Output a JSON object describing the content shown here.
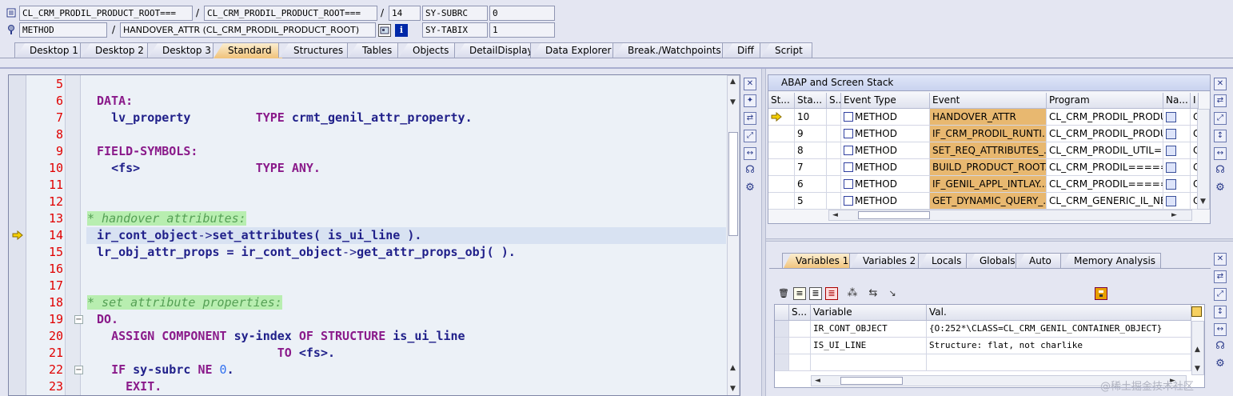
{
  "header": {
    "row1": {
      "class_name": "CL_CRM_PRODIL_PRODUCT_ROOT===",
      "include_name": "CL_CRM_PRODIL_PRODUCT_ROOT===",
      "line": "14",
      "sy_label": "SY-SUBRC",
      "sy_value": "0"
    },
    "row2": {
      "type": "METHOD",
      "method": "HANDOVER_ATTR (CL_CRM_PRODIL_PRODUCT_ROOT)",
      "sy_label": "SY-TABIX",
      "sy_value": "1"
    },
    "slash": "/"
  },
  "tabs": [
    "Desktop 1",
    "Desktop 2",
    "Desktop 3",
    "Standard",
    "Structures",
    "Tables",
    "Objects",
    "DetailDisplay",
    "Data Explorer",
    "Break./Watchpoints",
    "Diff",
    "Script"
  ],
  "active_tab": "Standard",
  "code_lines": [
    {
      "n": "5"
    },
    {
      "n": "6"
    },
    {
      "n": "7"
    },
    {
      "n": "8"
    },
    {
      "n": "9"
    },
    {
      "n": "10"
    },
    {
      "n": "11"
    },
    {
      "n": "12"
    },
    {
      "n": "13"
    },
    {
      "n": "14"
    },
    {
      "n": "15"
    },
    {
      "n": "16"
    },
    {
      "n": "17"
    },
    {
      "n": "18"
    },
    {
      "n": "19"
    },
    {
      "n": "20"
    },
    {
      "n": "21"
    },
    {
      "n": "22"
    },
    {
      "n": "23"
    }
  ],
  "code": {
    "l6_kw": "DATA:",
    "l7_var": "lv_property",
    "l7_type": "TYPE",
    "l7_ref": "crmt_genil_attr_property.",
    "l9_kw": "FIELD-SYMBOLS:",
    "l10_var": "<fs>",
    "l10_type": "TYPE",
    "l10_any": "ANY.",
    "l13_cmt": "* handover attributes:",
    "l14_a": "ir_cont_object",
    "l14_b": "->",
    "l14_c": "set_attributes",
    "l14_d": "( is_ui_line ).",
    "l15_a": "lr_obj_attr_props = ir_cont_object",
    "l15_b": "->",
    "l15_c": "get_attr_props_obj",
    "l15_d": "( ).",
    "l18_cmt": "* set attribute properties:",
    "l19_kw": "DO.",
    "l20_a": "ASSIGN COMPONENT",
    "l20_b": "sy-index",
    "l20_c": "OF STRUCTURE",
    "l20_d": "is_ui_line",
    "l21_a": "TO",
    "l21_b": "<fs>.",
    "l22_a": "IF",
    "l22_b": "sy-subrc",
    "l22_c": "NE",
    "l22_d": "0",
    "l22_e": ".",
    "l23_a": "EXIT."
  },
  "stack": {
    "title": "ABAP and Screen Stack",
    "headers": [
      "St...",
      "Sta...",
      "S...",
      "Event Type",
      "Event",
      "Program",
      "Na...",
      "I"
    ],
    "rows": [
      {
        "num": "10",
        "type": "METHOD",
        "event": "HANDOVER_ATTR",
        "program": "CL_CRM_PRODIL_PRODU...",
        "i": "C",
        "current": true
      },
      {
        "num": "9",
        "type": "METHOD",
        "event": "IF_CRM_PRODIL_RUNTI...",
        "program": "CL_CRM_PRODIL_PRODU...",
        "i": "C"
      },
      {
        "num": "8",
        "type": "METHOD",
        "event": "SET_REQ_ATTRIBUTES_...",
        "program": "CL_CRM_PRODIL_UTIL=...",
        "i": "C"
      },
      {
        "num": "7",
        "type": "METHOD",
        "event": "BUILD_PRODUCT_ROOT...",
        "program": "CL_CRM_PRODIL=====...",
        "i": "C"
      },
      {
        "num": "6",
        "type": "METHOD",
        "event": "IF_GENIL_APPL_INTLAY...",
        "program": "CL_CRM_PRODIL=====...",
        "i": "C"
      },
      {
        "num": "5",
        "type": "METHOD",
        "event": "GET_DYNAMIC_QUERY_...",
        "program": "CL_CRM_GENERIC_IL_NE...",
        "i": "C"
      }
    ]
  },
  "var_tabs": [
    "Variables 1",
    "Variables 2",
    "Locals",
    "Globals",
    "Auto",
    "Memory Analysis"
  ],
  "active_var_tab": "Variables 1",
  "variables": {
    "headers": [
      "S...",
      "Variable",
      "Val."
    ],
    "rows": [
      {
        "name": "IR_CONT_OBJECT",
        "value": "{O:252*\\CLASS=CL_CRM_GENIL_CONTAINER_OBJECT}"
      },
      {
        "name": "IS_UI_LINE",
        "value": "Structure: flat, not charlike"
      }
    ]
  },
  "watermark": "@稀土掘金技术社区"
}
